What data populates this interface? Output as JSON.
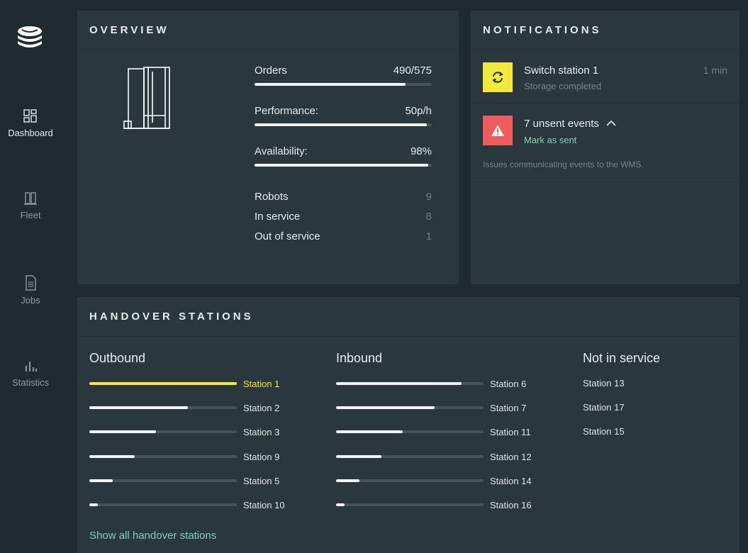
{
  "sidebar": {
    "items": [
      {
        "label": "Dashboard",
        "icon": "dashboard-icon",
        "active": true
      },
      {
        "label": "Fleet",
        "icon": "fleet-icon",
        "active": false
      },
      {
        "label": "Jobs",
        "icon": "jobs-icon",
        "active": false
      },
      {
        "label": "Statistics",
        "icon": "statistics-icon",
        "active": false
      }
    ]
  },
  "overview": {
    "title": "OVERVIEW",
    "metrics": [
      {
        "label": "Orders",
        "value": "490/575",
        "fraction": 0.85
      },
      {
        "label": "Performance:",
        "value": "50p/h",
        "fraction": 0.97
      },
      {
        "label": "Availability:",
        "value": "98%",
        "fraction": 0.98
      }
    ],
    "stats": [
      {
        "label": "Robots",
        "value": "9"
      },
      {
        "label": "In service",
        "value": "8"
      },
      {
        "label": "Out of service",
        "value": "1"
      }
    ]
  },
  "notifications": {
    "title": "NOTIFICATIONS",
    "items": [
      {
        "icon": "sync-icon",
        "icon_color": "#f1ea3c",
        "title": "Switch station 1",
        "subtitle": "Storage completed",
        "time": "1 min"
      },
      {
        "icon": "warning-icon",
        "icon_color": "#f05b5b",
        "title": "7 unsent events",
        "link": "Mark as sent",
        "description": "Issues communicating events to the WMS."
      }
    ]
  },
  "handover": {
    "title": "HANDOVER STATIONS",
    "outbound": {
      "title": "Outbound",
      "stations": [
        {
          "label": "Station 1",
          "fraction": 1.0,
          "highlight": true
        },
        {
          "label": "Station 2",
          "fraction": 0.67
        },
        {
          "label": "Station 3",
          "fraction": 0.45
        },
        {
          "label": "Station 9",
          "fraction": 0.31
        },
        {
          "label": "Station 5",
          "fraction": 0.16
        },
        {
          "label": "Station 10",
          "fraction": 0.06
        }
      ]
    },
    "inbound": {
      "title": "Inbound",
      "stations": [
        {
          "label": "Station 6",
          "fraction": 0.85
        },
        {
          "label": "Station 7",
          "fraction": 0.67
        },
        {
          "label": "Station 11",
          "fraction": 0.45
        },
        {
          "label": "Station 12",
          "fraction": 0.31
        },
        {
          "label": "Station 14",
          "fraction": 0.16
        },
        {
          "label": "Station 16",
          "fraction": 0.06
        }
      ]
    },
    "not_in_service": {
      "title": "Not in service",
      "stations": [
        "Station 13",
        "Station 17",
        "Station 15"
      ]
    },
    "show_all": "Show all handover stations"
  },
  "colors": {
    "accent_green": "#7fd3b5",
    "highlight_yellow": "#f1ea3c",
    "alert_red": "#f05b5b"
  }
}
